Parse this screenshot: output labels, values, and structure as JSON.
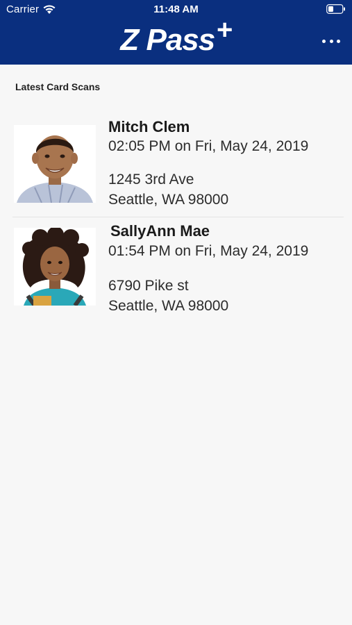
{
  "status_bar": {
    "carrier": "Carrier",
    "time": "11:48 AM"
  },
  "header": {
    "logo_text": "Z Pass",
    "logo_plus": "+",
    "more_icon": "more-horizontal-icon",
    "background_color": "#0a2f7f"
  },
  "section": {
    "title": "Latest Card Scans"
  },
  "scans": [
    {
      "name": "Mitch Clem",
      "timestamp": "02:05 PM on Fri, May 24, 2019",
      "address_line1": "1245 3rd Ave",
      "address_line2": "Seattle, WA 98000"
    },
    {
      "name": "SallyAnn Mae",
      "timestamp": "01:54 PM on Fri, May 24, 2019",
      "address_line1": "6790 Pike st",
      "address_line2": "Seattle, WA 98000"
    }
  ]
}
